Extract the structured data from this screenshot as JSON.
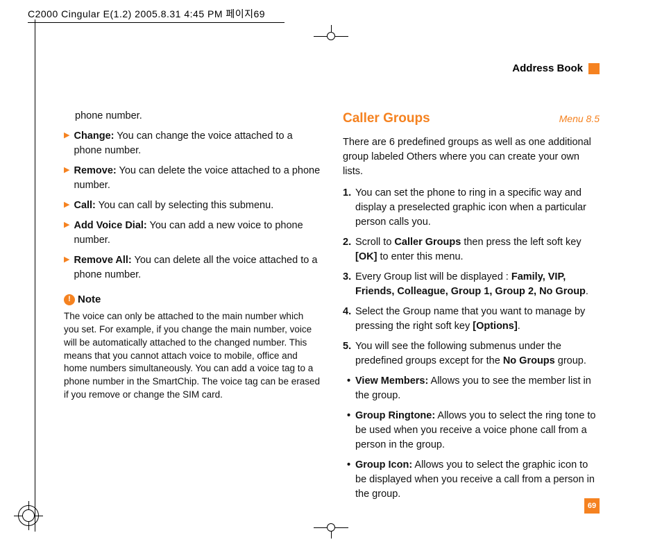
{
  "header_strip": "C2000 Cingular  E(1.2)  2005.8.31  4:45 PM  페이지69",
  "section_tab": "Address Book",
  "page_number": "69",
  "left": {
    "orphan": "phone number.",
    "bullets": [
      {
        "label": "Change:",
        "text": " You can change the voice attached to a phone number."
      },
      {
        "label": "Remove:",
        "text": " You can delete the voice attached to a phone number."
      },
      {
        "label": "Call:",
        "text": " You can call by selecting this submenu."
      },
      {
        "label": "Add Voice Dial:",
        "text": " You can add a new voice to phone number."
      },
      {
        "label": "Remove All:",
        "text": " You can delete all the voice attached to a phone number."
      }
    ],
    "note_label": "Note",
    "note_body": "The voice can only be attached to the main number which you set. For example, if you change the main number, voice will be automatically attached to the changed number. This means that you cannot attach voice to mobile, office and home numbers simultaneously. You can add a voice tag to a phone number in the SmartChip. The voice tag can be erased if you remove or change the SIM card."
  },
  "right": {
    "heading": "Caller Groups",
    "menu": "Menu 8.5",
    "intro": "There are 6 predefined groups as well as one additional group labeled Others where you can create your own lists.",
    "steps": {
      "s1": "You can set the phone to ring in a specific way and display a preselected graphic icon when a particular person calls you.",
      "s2_a": "Scroll to ",
      "s2_b": "Caller Groups",
      "s2_c": " then press the left soft key ",
      "s2_d": "[OK]",
      "s2_e": " to enter this menu.",
      "s3_a": "Every Group list will be displayed : ",
      "s3_list": "Family, VIP, Friends, Colleague, Group 1, Group 2, No Group",
      "s3_end": ".",
      "s4_a": "Select the Group name that you want to manage by pressing the right soft key ",
      "s4_b": "[Options]",
      "s4_c": ".",
      "s5_a": "You will see the following submenus under the predefined groups except for the ",
      "s5_b": "No Groups",
      "s5_c": " group."
    },
    "subs": [
      {
        "label": "View Members:",
        "text": " Allows you to see the member list in the group."
      },
      {
        "label": "Group Ringtone:",
        "text": " Allows you to select the ring tone to be used when you receive a voice phone call from a person in the group."
      },
      {
        "label": "Group Icon:",
        "text": " Allows you to select the graphic icon to be displayed when you receive a call from a person in the group."
      }
    ]
  }
}
